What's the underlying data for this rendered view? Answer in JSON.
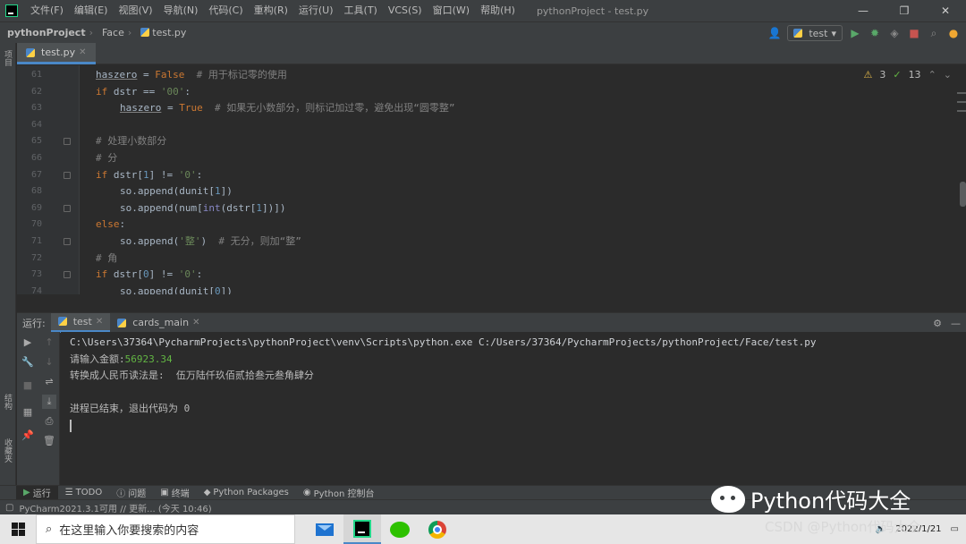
{
  "titlebar": {
    "menu": [
      "文件(F)",
      "编辑(E)",
      "视图(V)",
      "导航(N)",
      "代码(C)",
      "重构(R)",
      "运行(U)",
      "工具(T)",
      "VCS(S)",
      "窗口(W)",
      "帮助(H)"
    ],
    "title": "pythonProject - test.py",
    "controls": [
      "—",
      "❐",
      "✕"
    ]
  },
  "navbar": {
    "project": "pythonProject",
    "folder": "Face",
    "file": "test.py",
    "run_config": "test"
  },
  "left_strip": [
    "项目",
    "结构",
    "收藏夹"
  ],
  "editor": {
    "tab": "test.py",
    "inspections": {
      "warnings": "3",
      "ok": "13"
    },
    "lines": [
      {
        "num": "61",
        "text": ""
      },
      {
        "num": "62",
        "text": ""
      },
      {
        "num": "63",
        "text": ""
      },
      {
        "num": "64",
        "text": ""
      },
      {
        "num": "65",
        "text": ""
      },
      {
        "num": "66",
        "text": ""
      },
      {
        "num": "67",
        "text": ""
      },
      {
        "num": "68",
        "text": ""
      },
      {
        "num": "69",
        "text": ""
      },
      {
        "num": "70",
        "text": ""
      },
      {
        "num": "71",
        "text": ""
      },
      {
        "num": "72",
        "text": ""
      },
      {
        "num": "73",
        "text": ""
      },
      {
        "num": "74",
        "text": ""
      }
    ],
    "code": {
      "l61_var": "haszero",
      "l61_eq": " = ",
      "l61_kw": "False",
      "l61_cmt": "  # 用于标记零的使用",
      "l62_kw": "if",
      "l62_rest": " dstr == ",
      "l62_str": "'00'",
      "l62_colon": ":",
      "l63_var": "haszero",
      "l63_eq": " = ",
      "l63_kw": "True",
      "l63_cmt": "  # 如果无小数部分，则标记加过零，避免出现“圆零整”",
      "l65_cmt": "# 处理小数部分",
      "l66_cmt": "# 分",
      "l67_kw": "if",
      "l67_a": " dstr[",
      "l67_num": "1",
      "l67_b": "] != ",
      "l67_str": "'0'",
      "l67_c": ":",
      "l68_a": "so.append(dunit[",
      "l68_num": "1",
      "l68_b": "])",
      "l69_a": "so.append(num[",
      "l69_builtin": "int",
      "l69_b": "(dstr[",
      "l69_num": "1",
      "l69_c": "])])",
      "l70_kw": "else",
      "l70_colon": ":",
      "l71_a": "so.append(",
      "l71_str": "'整'",
      "l71_b": ")",
      "l71_cmt": "  # 无分，则加“整”",
      "l72_cmt": "# 角",
      "l73_kw": "if",
      "l73_a": " dstr[",
      "l73_num": "0",
      "l73_b": "] != ",
      "l73_str": "'0'",
      "l73_c": ":",
      "l74_a": "so.append(dunit[",
      "l74_num": "0",
      "l74_b": "])"
    }
  },
  "run_panel": {
    "label": "运行:",
    "tabs": [
      {
        "label": "test"
      },
      {
        "label": "cards_main"
      }
    ],
    "console": {
      "cmd": "C:\\Users\\37364\\PycharmProjects\\pythonProject\\venv\\Scripts\\python.exe C:/Users/37364/PycharmProjects/pythonProject/Face/test.py",
      "prompt": "请输入金额:",
      "input": "56923.34",
      "result": "转换成人民币读法是:  伍万陆仟玖佰贰拾叁元叁角肆分",
      "exit": "进程已结束，退出代码为 0"
    }
  },
  "tool_windows": [
    "运行",
    "TODO",
    "问题",
    "终端",
    "Python Packages",
    "Python 控制台"
  ],
  "statusbar": {
    "text": "PyCharm2021.3.1可用 // 更新... (今天 10:46)"
  },
  "watermark": {
    "main": "Python代码大全",
    "small": "CSDN @Python代码大全"
  },
  "taskbar": {
    "search_placeholder": "在这里输入你要搜索的内容",
    "date": "2022/1/21"
  },
  "colors": {
    "accent": "#4a88c7",
    "run_green": "#59a869",
    "stop_red": "#c75450"
  }
}
